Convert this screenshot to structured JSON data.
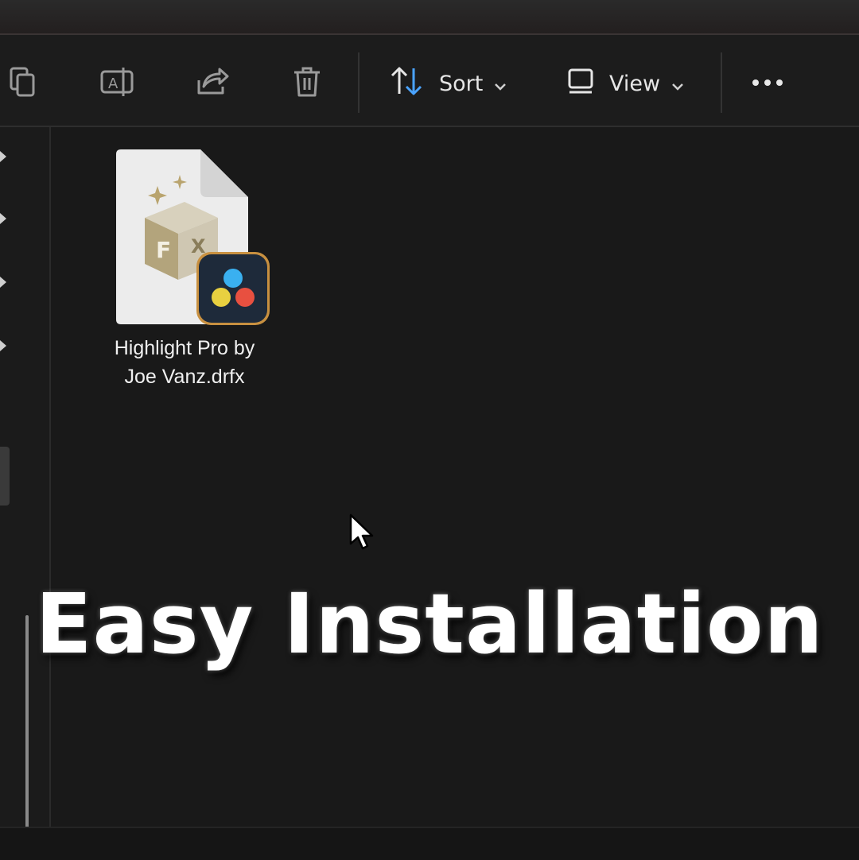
{
  "toolbar": {
    "sort_label": "Sort",
    "view_label": "View",
    "icons": [
      "copy-icon",
      "rename-icon",
      "share-icon",
      "delete-icon",
      "sort-icon",
      "view-icon",
      "more-icon"
    ],
    "accent": "#4aa3ff"
  },
  "file": {
    "name_line1": "Highlight Pro by",
    "name_line2": "Joe Vanz.drfx",
    "icon": "drfx-file-icon",
    "badge_icon": "davinci-resolve-icon"
  },
  "caption": {
    "text": "Easy Installation"
  }
}
